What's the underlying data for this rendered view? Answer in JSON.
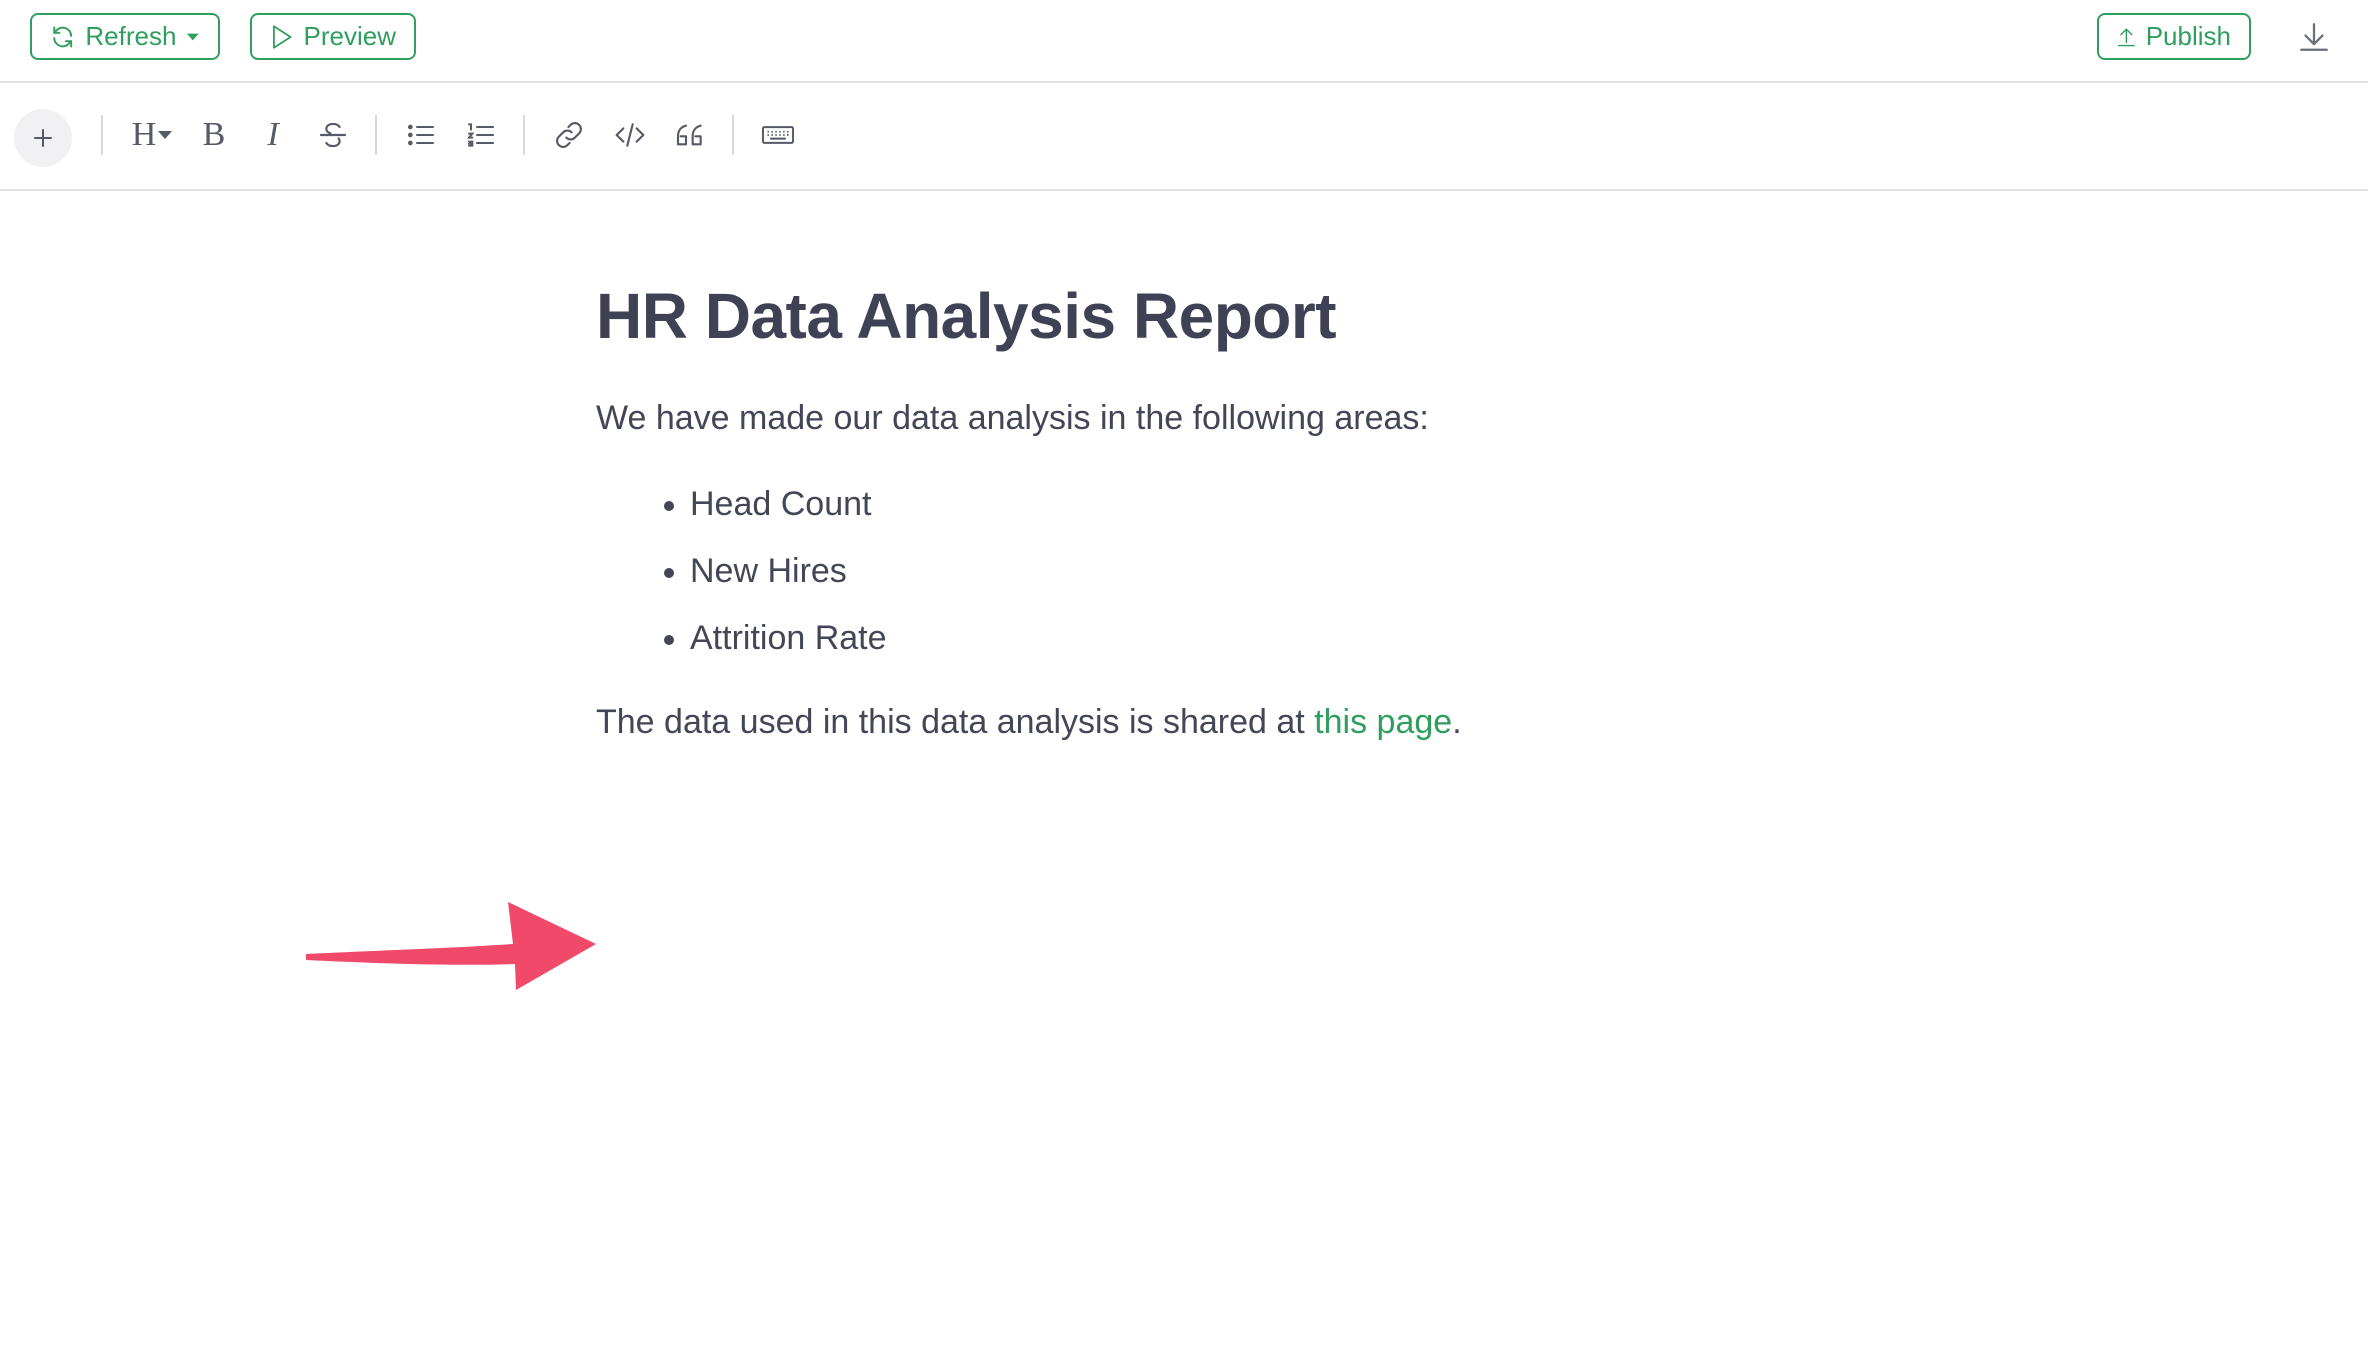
{
  "header": {
    "refresh_label": "Refresh",
    "preview_label": "Preview",
    "publish_label": "Publish"
  },
  "toolbar": {
    "buttons": [
      "plus",
      "heading",
      "bold",
      "italic",
      "strikethrough",
      "bullet-list",
      "numbered-list",
      "link",
      "code",
      "quote",
      "keyboard"
    ],
    "heading_glyph": "H",
    "bold_glyph": "B",
    "italic_glyph": "I"
  },
  "document": {
    "title": "HR Data Analysis Report",
    "intro": "We have made our data analysis in the following areas:",
    "areas": [
      "Head Count",
      "New Hires",
      "Attrition Rate"
    ],
    "closing_prefix": "The data used in this data analysis is shared at ",
    "closing_link": "this page",
    "closing_suffix": "."
  },
  "colors": {
    "accent": "#2f9e5f",
    "text": "#424656",
    "annotation_arrow": "#f0496a"
  }
}
